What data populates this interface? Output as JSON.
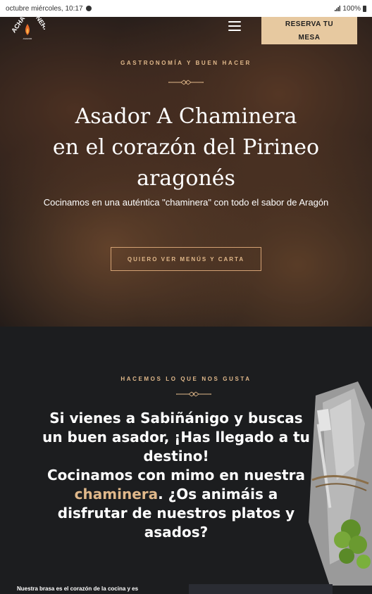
{
  "status_bar": {
    "datetime": "octubre miércoles, 10:17",
    "battery": "100%"
  },
  "header": {
    "logo_text": "ACHAMINERA",
    "reserve_label_line1": "RESERVA TU",
    "reserve_label_line2": "MESA"
  },
  "hero": {
    "eyebrow": "GASTRONOMÍA Y BUEN HACER",
    "title_line1": "Asador A Chaminera",
    "title_line2": "en el corazón del Pirineo",
    "title_line3": "aragonés",
    "subtitle": "Cocinamos en una auténtica \"chaminera\" con todo el sabor de Aragón",
    "cta": "QUIERO VER MENÚS Y CARTA"
  },
  "about": {
    "eyebrow": "HACEMOS LO QUE NOS GUSTA",
    "title_part1": "Si vienes a Sabiñánigo y buscas un buen asador, ¡Has llegado a tu destino!",
    "title_part2": "Cocinamos con mimo en nuestra",
    "title_accent": "chaminera",
    "title_part3": ". ¿Os animáis a disfrutar de nuestros platos y asados?",
    "body_start": "Nuestra brasa es el corazón de la cocina y es"
  },
  "colors": {
    "accent": "#e0b88a",
    "button_bg": "#e7c9a0",
    "dark_bg": "#1c1d1f"
  }
}
